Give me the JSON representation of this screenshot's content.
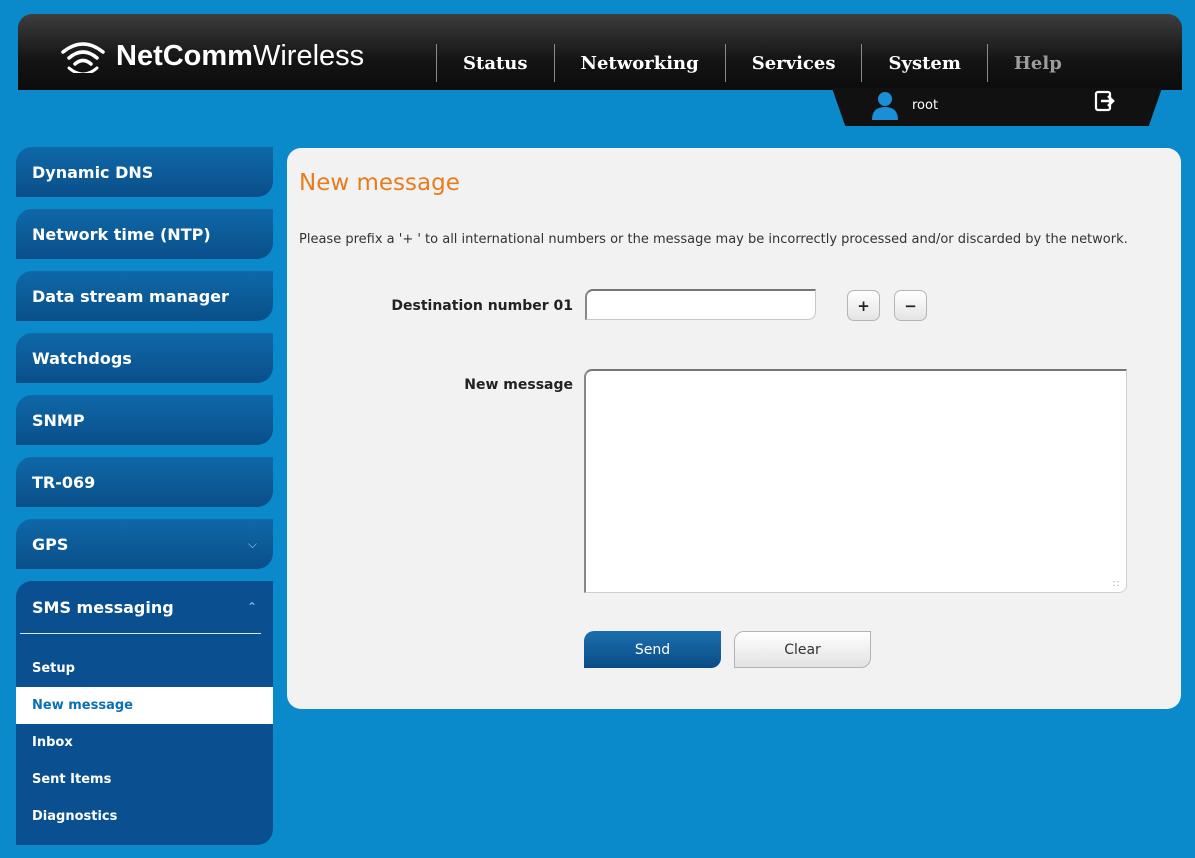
{
  "header": {
    "brand_bold": "NetComm",
    "brand_light": "Wireless",
    "nav": [
      "Status",
      "Networking",
      "Services",
      "System",
      "Help"
    ],
    "user": "root",
    "logo_icon": "wifi-icon",
    "user_icon": "user-icon",
    "logout_icon": "logout-icon"
  },
  "sidebar": {
    "items": [
      {
        "label": "Dynamic DNS"
      },
      {
        "label": "Network time (NTP)"
      },
      {
        "label": "Data stream manager"
      },
      {
        "label": "Watchdogs"
      },
      {
        "label": "SNMP"
      },
      {
        "label": "TR-069"
      },
      {
        "label": "GPS",
        "chevron": "chevron-down-icon"
      }
    ],
    "group": {
      "label": "SMS messaging",
      "chevron": "chevron-up-icon",
      "subitems": [
        "Setup",
        "New message",
        "Inbox",
        "Sent Items",
        "Diagnostics"
      ],
      "active": "New message"
    }
  },
  "main": {
    "title": "New message",
    "note": "Please prefix a '+ ' to all international numbers or the message may be incorrectly processed and/or discarded by the network.",
    "destination_label": "Destination number 01",
    "destination_value": "",
    "add_label": "+",
    "remove_label": "−",
    "message_label": "New message",
    "message_value": "",
    "send_label": "Send",
    "clear_label": "Clear"
  },
  "colors": {
    "background": "#0a8acb",
    "accent_orange": "#e77d1e",
    "sidebar_blue": "#0a5090"
  }
}
